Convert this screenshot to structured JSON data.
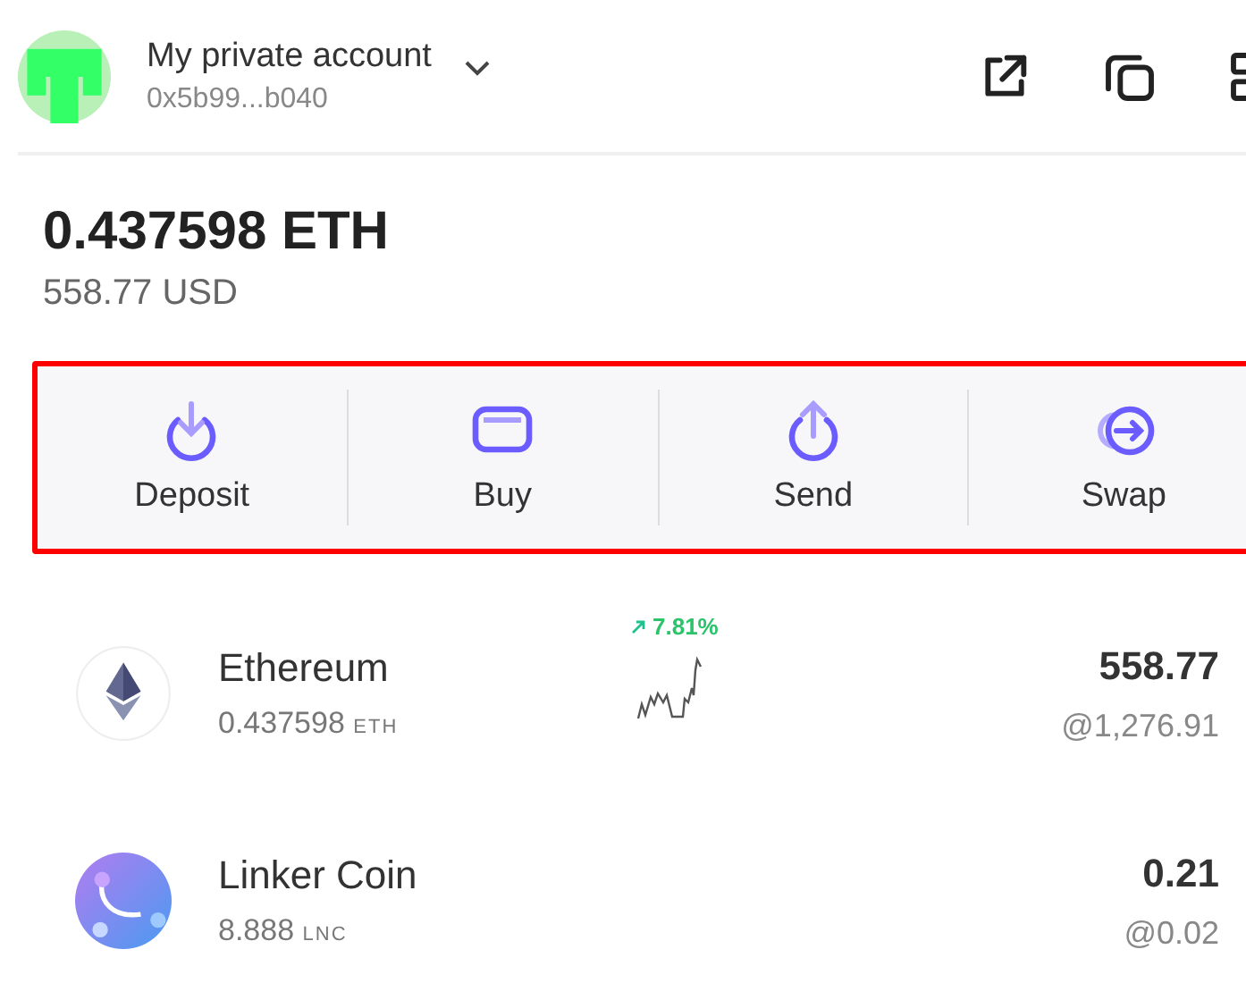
{
  "account": {
    "name": "My private account",
    "address": "0x5b99...b040"
  },
  "balance": {
    "amount": "0.437598 ETH",
    "fiat": "558.77 USD"
  },
  "actions": [
    {
      "kind": "deposit",
      "label": "Deposit"
    },
    {
      "kind": "buy",
      "label": "Buy"
    },
    {
      "kind": "send",
      "label": "Send"
    },
    {
      "kind": "swap",
      "label": "Swap"
    }
  ],
  "assets": [
    {
      "kind": "eth",
      "name": "Ethereum",
      "amount": "0.437598",
      "symbol": "ETH",
      "change": "7.81%",
      "value": "558.77",
      "price": "@1,276.91"
    },
    {
      "kind": "linker",
      "name": "Linker Coin",
      "amount": "8.888",
      "symbol": "LNC",
      "value": "0.21",
      "price": "@0.02"
    }
  ]
}
